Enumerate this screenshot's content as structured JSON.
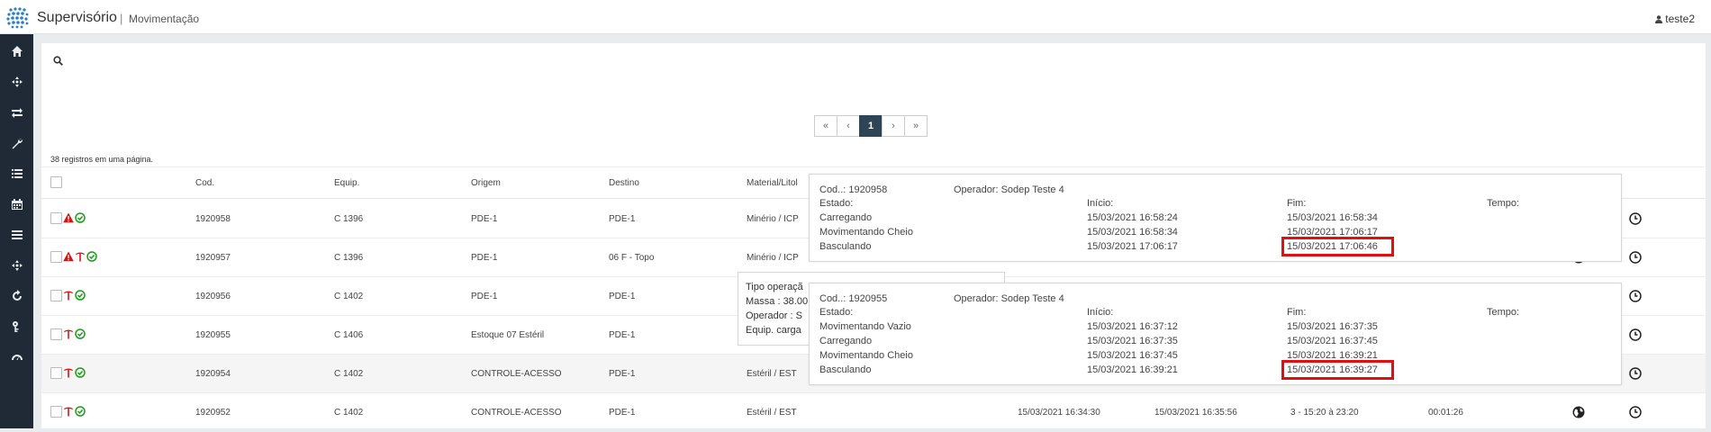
{
  "header": {
    "app_title": "Supervisório",
    "separator": "|",
    "page": "Movimentação",
    "user": "teste2"
  },
  "sidebar": {
    "items": [
      {
        "icon": "home-icon"
      },
      {
        "icon": "crosshair-icon"
      },
      {
        "icon": "transfer-icon"
      },
      {
        "icon": "wrench-icon"
      },
      {
        "icon": "list-icon"
      },
      {
        "icon": "calendar-icon"
      },
      {
        "icon": "menu-icon"
      },
      {
        "icon": "crosshair-icon"
      },
      {
        "icon": "refresh-icon"
      },
      {
        "icon": "key-icon"
      },
      {
        "icon": "dashboard-icon"
      }
    ]
  },
  "pagination": {
    "first": "«",
    "prev": "‹",
    "current": "1",
    "next": "›",
    "last": "»"
  },
  "records_count": "38 registros em uma página.",
  "table": {
    "columns": {
      "cod": "Cod.",
      "equip": "Equip.",
      "origem": "Origem",
      "destino": "Destino",
      "material": "Material/Litol"
    },
    "rows": [
      {
        "cod": "1920958",
        "equip": "C 1396",
        "origem": "PDE-1",
        "destino": "PDE-1",
        "material": "Minério / ICP",
        "inicio": "",
        "fim": "",
        "turno": "",
        "tempo": ""
      },
      {
        "cod": "1920957",
        "equip": "C 1396",
        "origem": "PDE-1",
        "destino": "06 F - Topo",
        "material": "Minério / ICP",
        "inicio": "",
        "fim": "",
        "turno": "",
        "tempo": ""
      },
      {
        "cod": "1920956",
        "equip": "C 1402",
        "origem": "PDE-1",
        "destino": "PDE-1",
        "material": "",
        "inicio": "",
        "fim": "",
        "turno": "",
        "tempo": ""
      },
      {
        "cod": "1920955",
        "equip": "C 1406",
        "origem": "Estoque 07 Estéril",
        "destino": "PDE-1",
        "material": "",
        "inicio": "",
        "fim": "",
        "turno": "",
        "tempo": ""
      },
      {
        "cod": "1920954",
        "equip": "C 1402",
        "origem": "CONTROLE-ACESSO",
        "destino": "PDE-1",
        "material": "Estéril / EST",
        "inicio": "",
        "fim": "",
        "turno": "",
        "tempo": ""
      },
      {
        "cod": "1920952",
        "equip": "C 1402",
        "origem": "CONTROLE-ACESSO",
        "destino": "PDE-1",
        "material": "Estéril / EST",
        "inicio": "15/03/2021 16:34:30",
        "fim": "15/03/2021 16:35:56",
        "turno": "3 - 15:20 à 23:20",
        "tempo": "00:01:26"
      }
    ]
  },
  "tooltip_back": {
    "line1": "Tipo operaçã",
    "line2": "Massa : 38.00",
    "line3": "Operador : S",
    "line4": "Equip. carga"
  },
  "tooltip1": {
    "cod_label": "Cod..: 1920958",
    "operador": "Operador: Sodep Teste 4",
    "h_estado": "Estado:",
    "h_inicio": "Início:",
    "h_fim": "Fim:",
    "h_tempo": "Tempo:",
    "rows": [
      {
        "estado": "Carregando",
        "inicio": "15/03/2021 16:58:24",
        "fim": "15/03/2021 16:58:34"
      },
      {
        "estado": "Movimentando Cheio",
        "inicio": "15/03/2021 16:58:34",
        "fim": "15/03/2021 17:06:17"
      },
      {
        "estado": "Basculando",
        "inicio": "15/03/2021 17:06:17",
        "fim": "15/03/2021 17:06:46"
      }
    ]
  },
  "tooltip2": {
    "cod_label": "Cod..: 1920955",
    "operador": "Operador: Sodep Teste 4",
    "h_estado": "Estado:",
    "h_inicio": "Início:",
    "h_fim": "Fim:",
    "h_tempo": "Tempo:",
    "rows": [
      {
        "estado": "Movimentando Vazio",
        "inicio": "15/03/2021 16:37:12",
        "fim": "15/03/2021 16:37:35"
      },
      {
        "estado": "Carregando",
        "inicio": "15/03/2021 16:37:35",
        "fim": "15/03/2021 16:37:45"
      },
      {
        "estado": "Movimentando Cheio",
        "inicio": "15/03/2021 16:37:45",
        "fim": "15/03/2021 16:39:21"
      },
      {
        "estado": "Basculando",
        "inicio": "15/03/2021 16:39:21",
        "fim": "15/03/2021 16:39:27"
      }
    ]
  },
  "colors": {
    "sidebar": "#1f2a36",
    "active_page": "#2f4455",
    "warning": "#e01010",
    "ok": "#1a9e1a",
    "highlight": "#e01010"
  }
}
